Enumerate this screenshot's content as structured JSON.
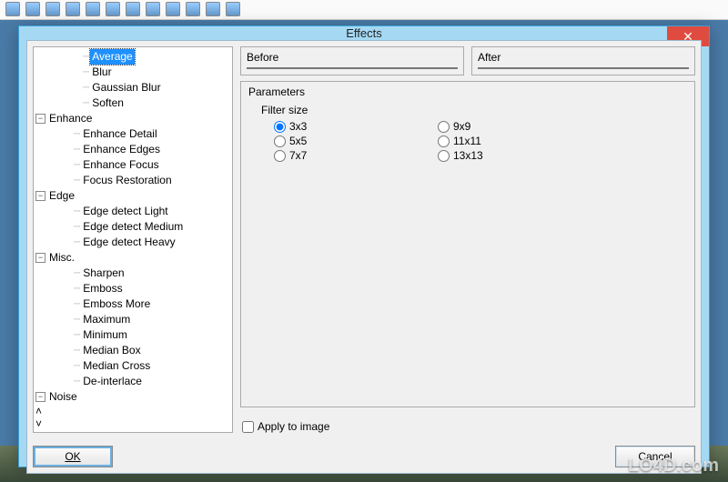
{
  "dialog": {
    "title": "Effects",
    "close_glyph": "✕"
  },
  "tree": {
    "blur_group": {
      "items": [
        "Average",
        "Blur",
        "Gaussian Blur",
        "Soften"
      ],
      "selected": "Average"
    },
    "enhance_group": {
      "label": "Enhance",
      "items": [
        "Enhance Detail",
        "Enhance Edges",
        "Enhance Focus",
        "Focus Restoration"
      ]
    },
    "edge_group": {
      "label": "Edge",
      "items": [
        "Edge detect Light",
        "Edge detect Medium",
        "Edge detect Heavy"
      ]
    },
    "misc_group": {
      "label": "Misc.",
      "items": [
        "Sharpen",
        "Emboss",
        "Emboss More",
        "Maximum",
        "Minimum",
        "Median Box",
        "Median Cross",
        "De-interlace"
      ]
    },
    "noise_group": {
      "label": "Noise"
    },
    "toggle_minus": "−",
    "scroll_up": "˄",
    "scroll_down": "˅"
  },
  "previews": {
    "before": "Before",
    "after": "After"
  },
  "parameters": {
    "title": "Parameters",
    "filter_size_label": "Filter size",
    "options_col1": [
      "3x3",
      "5x5",
      "7x7"
    ],
    "options_col2": [
      "9x9",
      "11x11",
      "13x13"
    ],
    "selected": "3x3"
  },
  "apply": {
    "label": "Apply to image",
    "checked": false
  },
  "buttons": {
    "ok": "OK",
    "cancel": "Cancel"
  },
  "watermark": "LO4D.com"
}
